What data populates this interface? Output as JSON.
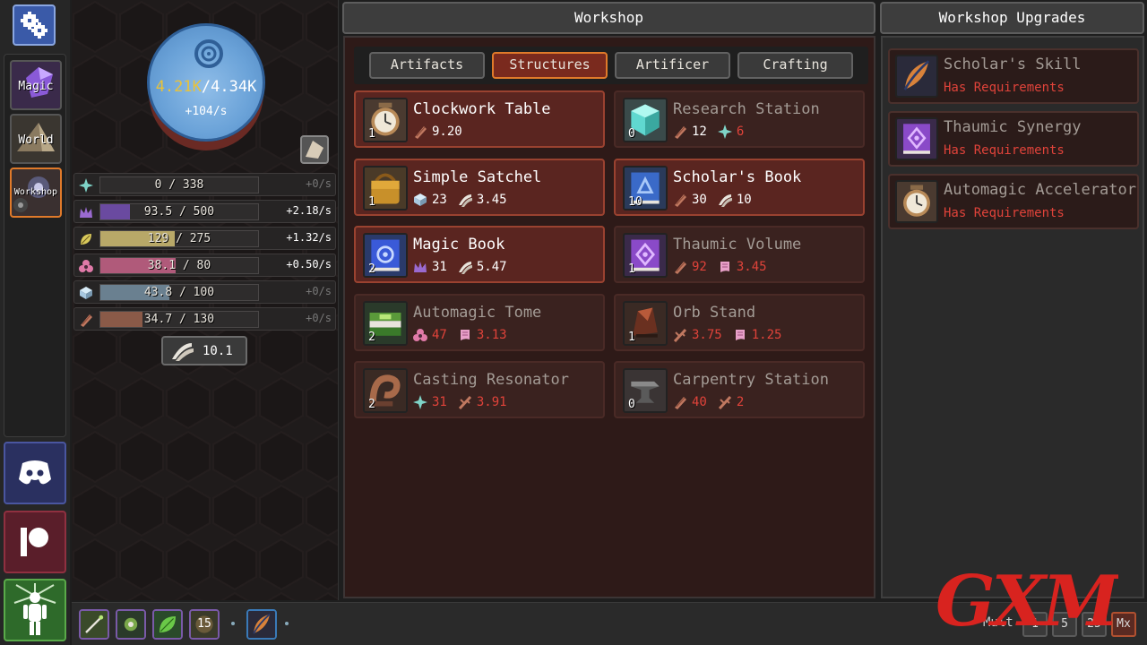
{
  "nav": {
    "items": [
      {
        "label": "Magic"
      },
      {
        "label": "World"
      },
      {
        "label": "Workshop"
      }
    ]
  },
  "mana": {
    "current": "4.21K",
    "separator": "/",
    "max": "4.34K",
    "rate": "+104/s"
  },
  "resources": [
    {
      "icon": "sparkle-icon",
      "text": "0 / 338",
      "rate": "+0/s",
      "fill": 0.0,
      "color": "#3f3f3f",
      "icon_color": "#7fd4c8"
    },
    {
      "icon": "crown-icon",
      "text": "93.5 / 500",
      "rate": "+2.18/s",
      "fill": 0.187,
      "color": "#6a4aa0",
      "icon_color": "#9a6ad0"
    },
    {
      "icon": "leaf-icon",
      "text": "129 / 275",
      "rate": "+1.32/s",
      "fill": 0.469,
      "color": "#b8a868",
      "icon_color": "#d8c85a"
    },
    {
      "icon": "trinity-icon",
      "text": "38.1 / 80",
      "rate": "+0.50/s",
      "fill": 0.476,
      "color": "#b05a7a",
      "icon_color": "#e07aa8"
    },
    {
      "icon": "cube-icon",
      "text": "43.8 / 100",
      "rate": "+0/s",
      "fill": 0.438,
      "color": "#6a8090",
      "icon_color": "#a8c8e0"
    },
    {
      "icon": "plank-icon",
      "text": "34.7 / 130",
      "rate": "+0/s",
      "fill": 0.267,
      "color": "#8a5a48",
      "icon_color": "#c07860"
    }
  ],
  "scrolls": {
    "value": "10.1"
  },
  "workshop": {
    "title": "Workshop",
    "tabs": [
      "Artifacts",
      "Structures",
      "Artificer",
      "Crafting"
    ],
    "active_tab": "Structures",
    "cards": [
      {
        "name": "Clockwork Table",
        "count": "1",
        "state": "available",
        "icon": "clock-icon",
        "costs": [
          {
            "icon": "plank-icon",
            "value": "9.20",
            "short": false
          }
        ]
      },
      {
        "name": "Research Station",
        "count": "0",
        "state": "locked",
        "icon": "crystal-icon",
        "costs": [
          {
            "icon": "plank-icon",
            "value": "12",
            "short": false
          },
          {
            "icon": "sparkle-icon",
            "value": "6",
            "short": true
          }
        ]
      },
      {
        "name": "Simple Satchel",
        "count": "1",
        "state": "available",
        "icon": "satchel-icon",
        "costs": [
          {
            "icon": "cube-icon",
            "value": "23",
            "short": false
          },
          {
            "icon": "scroll-icon",
            "value": "3.45",
            "short": false
          }
        ]
      },
      {
        "name": "Scholar's Book",
        "count": "10",
        "state": "available",
        "icon": "blue-book-icon",
        "costs": [
          {
            "icon": "plank-icon",
            "value": "30",
            "short": false
          },
          {
            "icon": "scroll-icon",
            "value": "10",
            "short": false
          }
        ]
      },
      {
        "name": "Magic Book",
        "count": "2",
        "state": "available",
        "icon": "magic-book-icon",
        "costs": [
          {
            "icon": "crown-icon",
            "value": "31",
            "short": false
          },
          {
            "icon": "scroll-icon",
            "value": "5.47",
            "short": false
          }
        ]
      },
      {
        "name": "Thaumic Volume",
        "count": "1",
        "state": "locked",
        "icon": "purple-book-icon",
        "costs": [
          {
            "icon": "plank-icon",
            "value": "92",
            "short": true
          },
          {
            "icon": "parchment-icon",
            "value": "3.45",
            "short": true
          }
        ]
      },
      {
        "name": "Automagic Tome",
        "count": "2",
        "state": "locked",
        "icon": "green-tome-icon",
        "costs": [
          {
            "icon": "trinity-icon",
            "value": "47",
            "short": true
          },
          {
            "icon": "parchment-icon",
            "value": "3.13",
            "short": true
          }
        ]
      },
      {
        "name": "Orb Stand",
        "count": "1",
        "state": "locked",
        "icon": "orb-stand-icon",
        "costs": [
          {
            "icon": "branch-icon",
            "value": "3.75",
            "short": true
          },
          {
            "icon": "parchment-icon",
            "value": "1.25",
            "short": true
          }
        ]
      },
      {
        "name": "Casting Resonator",
        "count": "2",
        "state": "locked",
        "icon": "resonator-icon",
        "costs": [
          {
            "icon": "sparkle-icon",
            "value": "31",
            "short": true
          },
          {
            "icon": "branch-icon",
            "value": "3.91",
            "short": true
          }
        ]
      },
      {
        "name": "Carpentry Station",
        "count": "0",
        "state": "locked",
        "icon": "anvil-icon",
        "costs": [
          {
            "icon": "plank-icon",
            "value": "40",
            "short": true
          },
          {
            "icon": "branch-icon",
            "value": "2",
            "short": true
          }
        ]
      }
    ]
  },
  "upgrades": {
    "title": "Workshop Upgrades",
    "items": [
      {
        "name": "Scholar's Skill",
        "requirement": "Has Requirements",
        "icon": "quill-icon"
      },
      {
        "name": "Thaumic Synergy",
        "requirement": "Has Requirements",
        "icon": "purple-book-icon"
      },
      {
        "name": "Automagic Accelerator",
        "requirement": "Has Requirements",
        "icon": "clock-icon"
      }
    ]
  },
  "bottombar": {
    "buffs": [
      {
        "icon": "wand-icon",
        "label": ""
      },
      {
        "icon": "seed-icon",
        "label": ""
      },
      {
        "icon": "leaf-icon",
        "label": ""
      },
      {
        "icon": "timer-icon",
        "label": "15"
      },
      {
        "icon": "quill-icon",
        "label": ""
      }
    ],
    "multiplier_label": "Mult",
    "multipliers": [
      "1",
      "5",
      "25",
      "Mx"
    ],
    "active_multiplier": "Mx"
  },
  "watermark": {
    "text": "GXM"
  },
  "colors": {
    "accent": "#e07a2a",
    "shortfall": "#e0433a",
    "available_card": "#5a2520",
    "locked_card": "#3a221f"
  }
}
